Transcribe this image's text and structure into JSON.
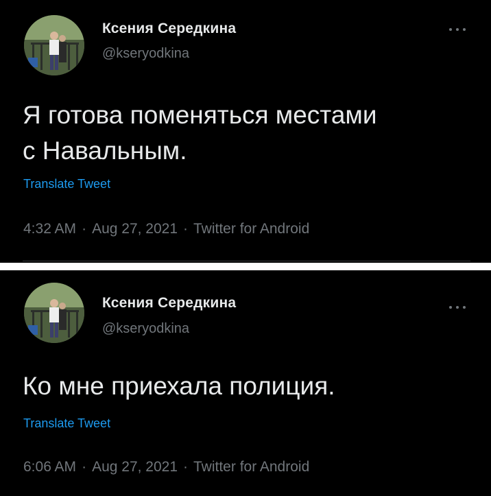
{
  "tweets": [
    {
      "author": {
        "display_name": "Ксения Середкина",
        "handle": "@kseryodkina"
      },
      "text_lines": [
        "Я готова поменяться местами",
        "с Навальным."
      ],
      "translate_label": "Translate Tweet",
      "time": "4:32 AM",
      "date": "Aug 27, 2021",
      "source": "Twitter for Android",
      "separator": "·"
    },
    {
      "author": {
        "display_name": "Ксения Середкина",
        "handle": "@kseryodkina"
      },
      "text_lines": [
        "Ко мне приехала полиция."
      ],
      "translate_label": "Translate Tweet",
      "time": "6:06 AM",
      "date": "Aug 27, 2021",
      "source": "Twitter for Android",
      "separator": "·"
    }
  ],
  "icons": {
    "more": "more-horizontal-icon",
    "avatar": "profile-photo"
  },
  "colors": {
    "background": "#000000",
    "text": "#e7e9ea",
    "secondary_text": "#71767b",
    "link": "#1d9bf0",
    "divider": "#ffffff"
  }
}
